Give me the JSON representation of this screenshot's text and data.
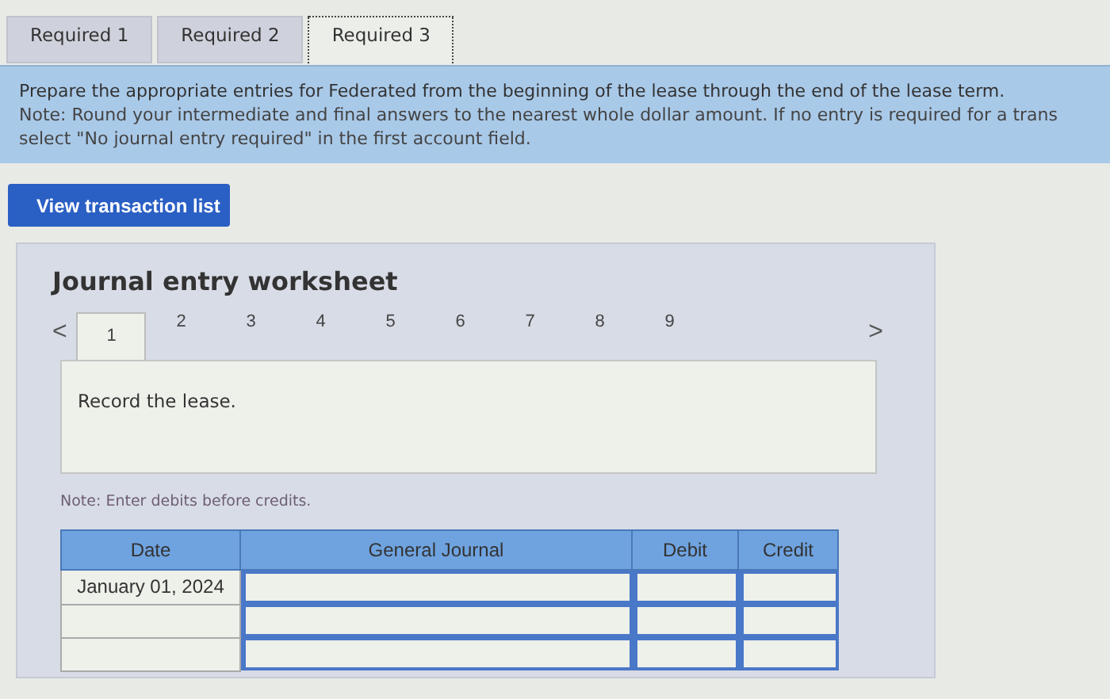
{
  "tabs": [
    {
      "label": "Required 1",
      "selected": false
    },
    {
      "label": "Required 2",
      "selected": false
    },
    {
      "label": "Required 3",
      "selected": true
    }
  ],
  "instructions": {
    "text": "Prepare the appropriate entries for Federated from the beginning of the lease through the end of the lease term.",
    "note_lines": [
      "Note: Round your intermediate and final answers to the nearest whole dollar amount. If no entry is required for a trans",
      "select \"No journal entry required\" in the first account field."
    ]
  },
  "view_button": "View transaction list",
  "worksheet": {
    "title": "Journal entry worksheet",
    "prev": "<",
    "next": ">",
    "steps": [
      {
        "label": "1",
        "selected": true
      },
      {
        "label": "2",
        "selected": false
      },
      {
        "label": "3",
        "selected": false
      },
      {
        "label": "4",
        "selected": false
      },
      {
        "label": "5",
        "selected": false
      },
      {
        "label": "6",
        "selected": false
      },
      {
        "label": "7",
        "selected": false
      },
      {
        "label": "8",
        "selected": false
      },
      {
        "label": "9",
        "selected": false
      }
    ],
    "description": "Record the lease.",
    "note": "Note: Enter debits before credits.",
    "table": {
      "columns": [
        "Date",
        "General Journal",
        "Debit",
        "Credit"
      ],
      "rows": [
        {
          "date": "January 01, 2024"
        },
        {},
        {}
      ]
    }
  }
}
